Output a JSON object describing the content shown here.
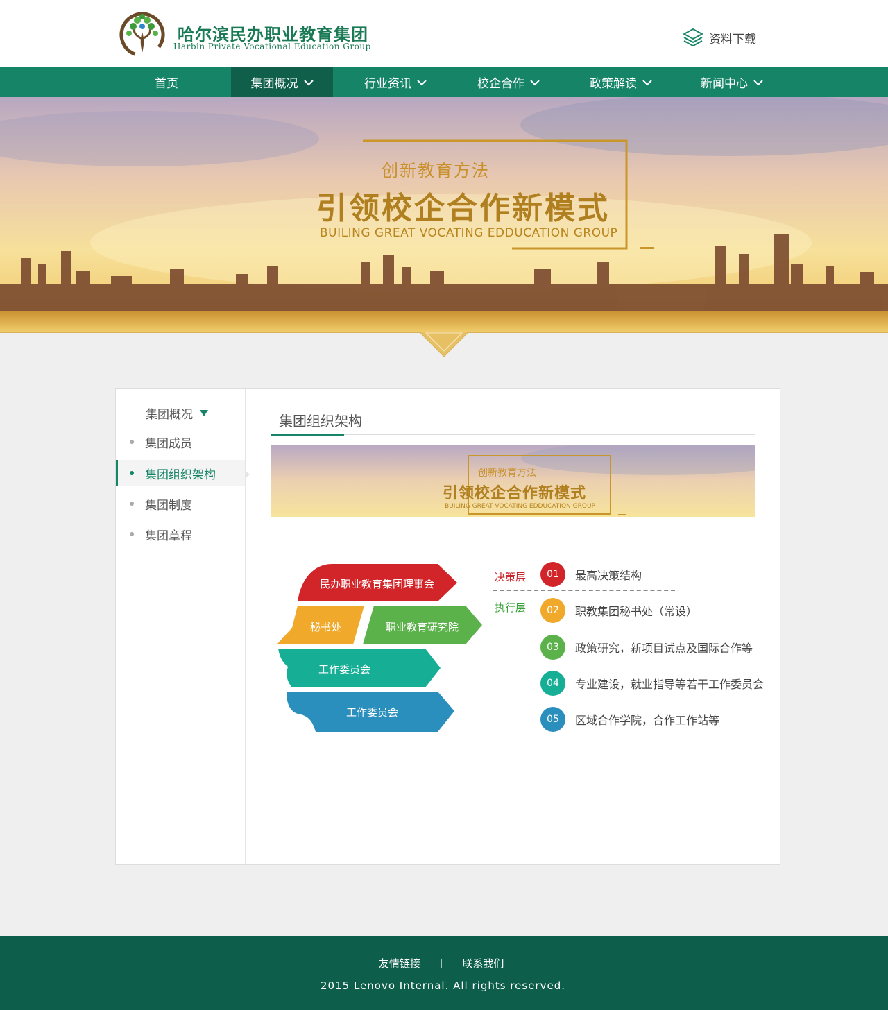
{
  "header": {
    "logo_cn": "哈尔滨民办职业教育集团",
    "logo_en": "Harbin Private Vocational Education Group",
    "download_label": "资料下载"
  },
  "nav": {
    "items": [
      {
        "label": "首页"
      },
      {
        "label": "集团概况"
      },
      {
        "label": "行业资讯"
      },
      {
        "label": "校企合作"
      },
      {
        "label": "政策解读"
      },
      {
        "label": "新闻中心"
      }
    ],
    "active": "集团概况"
  },
  "banner": {
    "subtitle": "创新教育方法",
    "title": "引领校企合作新模式",
    "english": "BUILING GREAT VOCATING EDDUCATION GROUP"
  },
  "sidebar": {
    "heading": "集团概况",
    "items": [
      {
        "label": "集团成员"
      },
      {
        "label": "集团组织架构"
      },
      {
        "label": "集团制度"
      },
      {
        "label": "集团章程"
      }
    ],
    "active": "集团组织架构"
  },
  "main": {
    "title": "集团组织架构",
    "mini_banner": {
      "subtitle": "创新教育方法",
      "title": "引领校企合作新模式",
      "english": "BUILING GREAT VOCATING EDDUCATION GROUP"
    }
  },
  "diagram": {
    "blocks": [
      {
        "label": "民办职业教育集团理事会",
        "color": "#d2252a"
      },
      {
        "label": "秘书处",
        "color": "#f0a92b"
      },
      {
        "label": "职业教育研究院",
        "color": "#5bb14a"
      },
      {
        "label": "工作委员会",
        "color": "#17ae96"
      },
      {
        "label": "工作委员会",
        "color": "#2a8fbd"
      }
    ],
    "layers": [
      {
        "label": "决策层",
        "color": "#c8262b"
      },
      {
        "label": "执行层",
        "color": "#3aa33a"
      }
    ],
    "steps": [
      {
        "num": "01",
        "text": "最高决策结构",
        "color": "#d2252a"
      },
      {
        "num": "02",
        "text": "职教集团秘书处（常设）",
        "color": "#f0a92b"
      },
      {
        "num": "03",
        "text": "政策研究，新项目试点及国际合作等",
        "color": "#5bb14a"
      },
      {
        "num": "04",
        "text": "专业建设，就业指导等若干工作委员会",
        "color": "#17ae96"
      },
      {
        "num": "05",
        "text": "区域合作学院，合作工作站等",
        "color": "#2a8fbd"
      }
    ]
  },
  "footer": {
    "link1": "友情链接",
    "separator": "|",
    "link2": "联系我们",
    "copyright": "2015 Lenovo Internal. All rights reserved."
  }
}
